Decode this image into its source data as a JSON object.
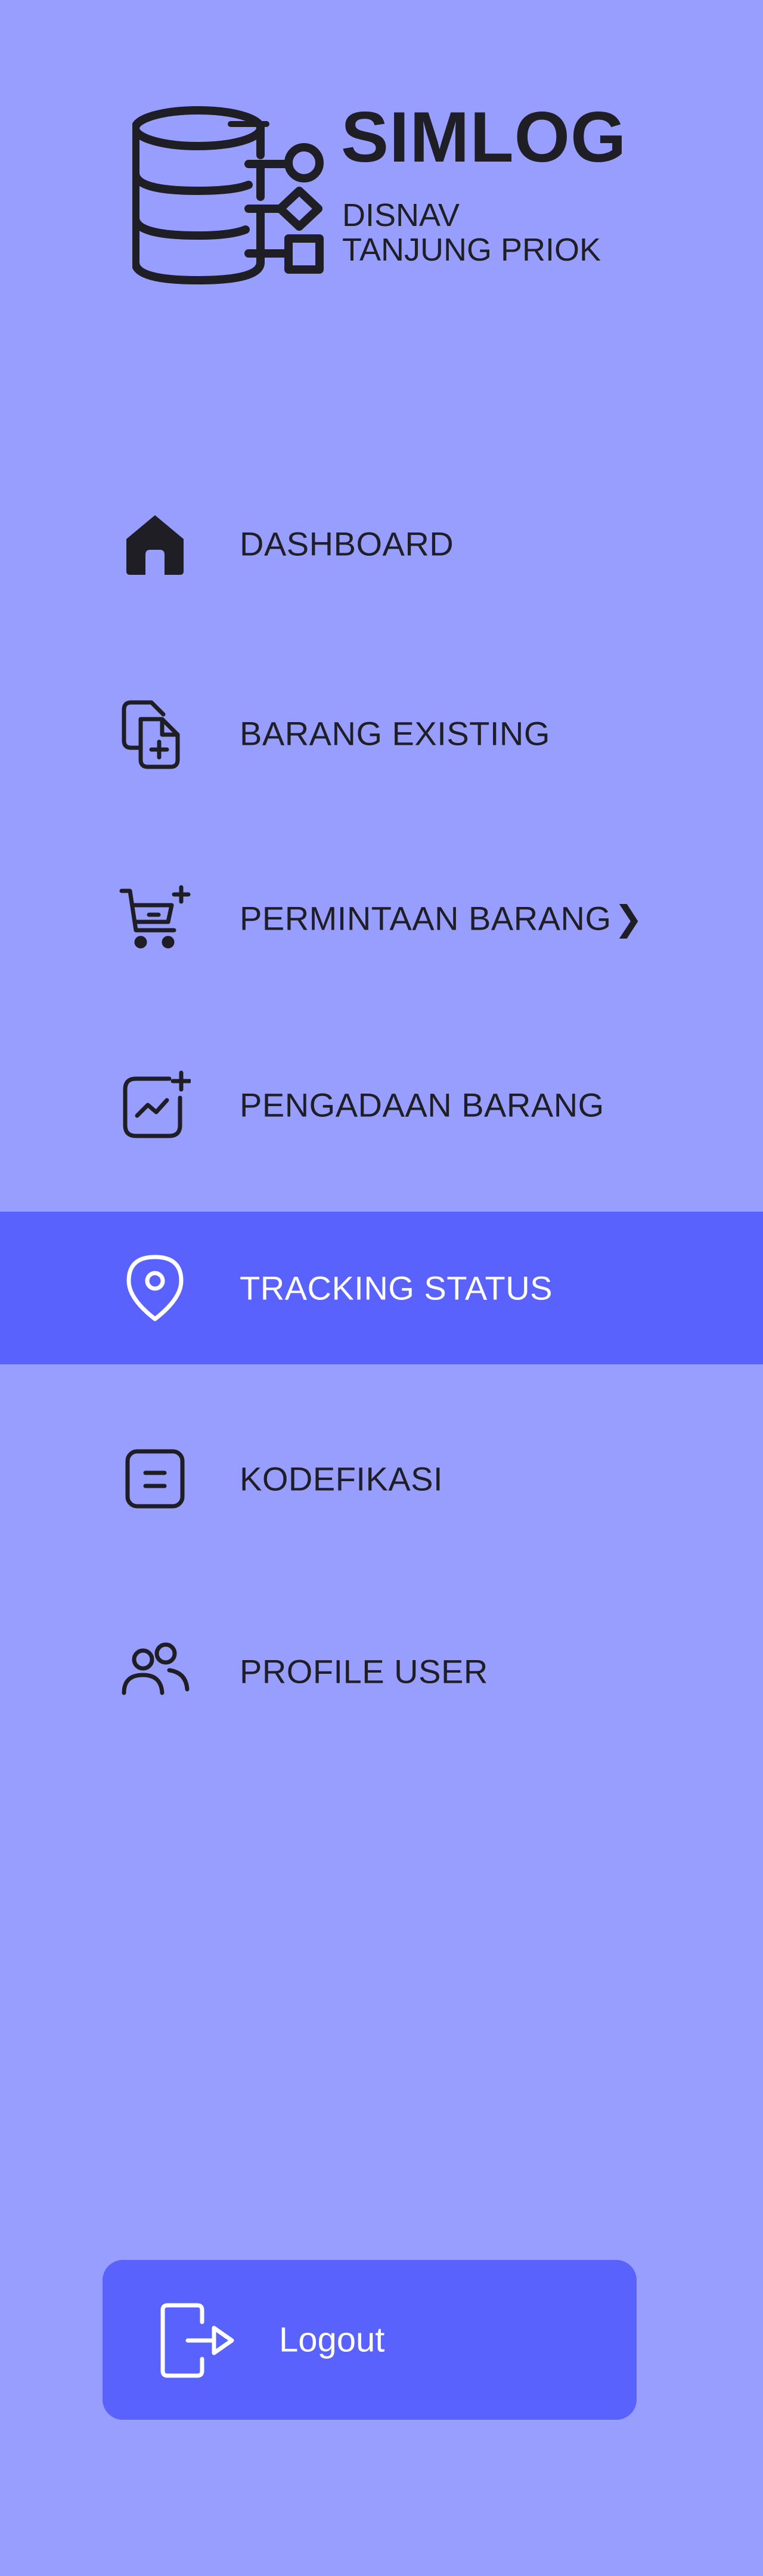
{
  "brand": {
    "title": "SIMLOG",
    "subtitle_line1": "DISNAV",
    "subtitle_line2": "TANJUNG PRIOK",
    "logo_icon": "database-flow-icon"
  },
  "menu": {
    "items": [
      {
        "label": "DASHBOARD",
        "icon": "home-icon",
        "active": false
      },
      {
        "label": "BARANG EXISTING",
        "icon": "file-add-icon",
        "active": false
      },
      {
        "label": "PERMINTAAN BARANG",
        "icon": "cart-add-icon",
        "active": false,
        "chevron": "❯"
      },
      {
        "label": "PENGADAAN BARANG",
        "icon": "chart-add-icon",
        "active": false
      },
      {
        "label": "TRACKING STATUS",
        "icon": "location-pin-icon",
        "active": true
      },
      {
        "label": "KODEFIKASI",
        "icon": "code-box-icon",
        "active": false
      },
      {
        "label": "PROFILE USER",
        "icon": "users-icon",
        "active": false
      }
    ]
  },
  "logout": {
    "label": "Logout",
    "icon": "logout-door-icon"
  },
  "colors": {
    "background": "#989efe",
    "accent": "#5a62fe",
    "text_dark": "#1e1e24",
    "text_light": "#ffffff"
  }
}
